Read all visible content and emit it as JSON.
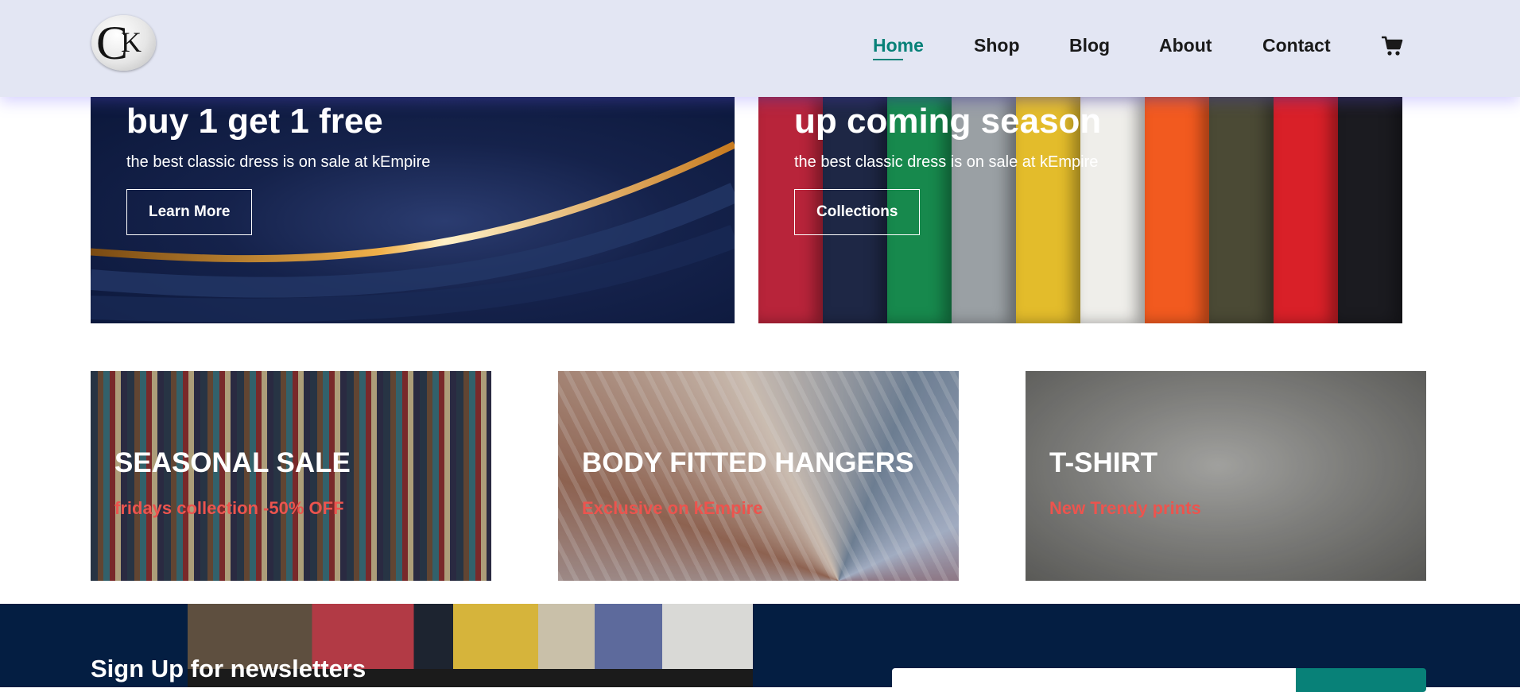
{
  "logo": {
    "letter_c": "C",
    "letter_k": "K"
  },
  "nav": {
    "items": [
      {
        "label": "Home",
        "active": true
      },
      {
        "label": "Shop",
        "active": false
      },
      {
        "label": "Blog",
        "active": false
      },
      {
        "label": "About",
        "active": false
      },
      {
        "label": "Contact",
        "active": false
      }
    ],
    "cart_icon": "cart-icon"
  },
  "heroes": [
    {
      "title": "buy 1 get 1 free",
      "subtitle": "the best classic dress is on sale at kEmpire",
      "button": "Learn More"
    },
    {
      "title": "up coming season",
      "subtitle": "the best classic dress is on sale at kEmpire",
      "button": "Collections"
    }
  ],
  "promos": [
    {
      "title": "SEASONAL SALE",
      "subtitle": "fridays collection -50% OFF"
    },
    {
      "title": "BODY FITTED HANGERS",
      "subtitle": "Exclusive on kEmpire"
    },
    {
      "title": "T-SHIRT",
      "subtitle": "New Trendy prints"
    }
  ],
  "newsletter": {
    "title": "Sign Up for newsletters"
  },
  "colors": {
    "accent": "#088178",
    "header_bg": "#e3e6f3",
    "navy": "#041e42",
    "promo_sub": "#ec544e"
  }
}
